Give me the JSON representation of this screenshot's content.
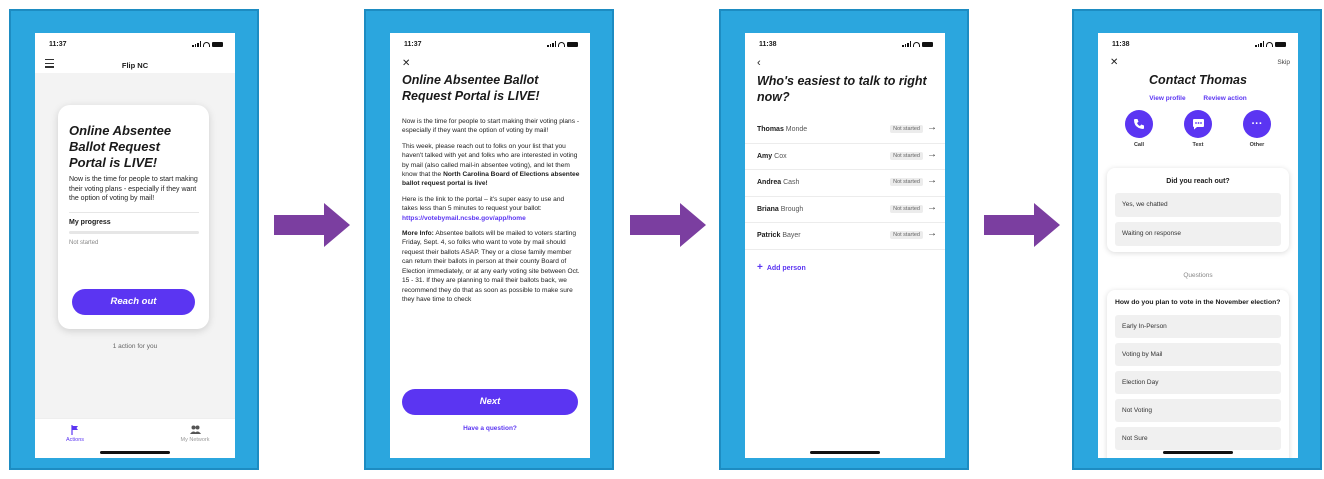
{
  "status": {
    "time1": "11:37",
    "time2": "11:37",
    "time3": "11:38",
    "time4": "11:38"
  },
  "screen1": {
    "header_title": "Flip NC",
    "card_title": "Online Absentee Ballot Request Portal is LIVE!",
    "card_body": "Now is the time for people to start making their voting plans - especially if they want the option of voting by mail!",
    "progress_label": "My progress",
    "progress_status": "Not started",
    "progress": 0,
    "cta": "Reach out",
    "actions_count": "1 action for you",
    "tabs": [
      {
        "label": "Actions",
        "icon": "flag-icon"
      },
      {
        "label": "My Network",
        "icon": "people-icon"
      }
    ]
  },
  "screen2": {
    "title": "Online Absentee Ballot Request Portal is LIVE!",
    "p1": "Now is the time for people to start making their voting plans - especially if they want the option of voting by mail!",
    "p2_a": "This week, please reach out to folks on your list that you haven't talked with yet and folks who are interested in voting by mail (also called mail-in absentee voting), and let them know that the ",
    "p2_b": "North Carolina Board of Elections absentee ballot request portal is live!",
    "p3_a": "Here is the link to the portal – it's super easy to use and takes less than 5 minutes to request your ballot: ",
    "p3_link": "https://votebymail.ncsbe.gov/app/home",
    "p4_label": "More Info:",
    "p4": " Absentee ballots will be mailed to voters starting Friday, Sept. 4, so folks who want to vote by mail should request their ballots ASAP. They or a close family member can return their ballots in person at their county Board of Election immediately, or at any early voting site between Oct. 15 - 31. If they are planning to mail their ballots back, we recommend they do that as soon as possible to make sure they have time to check",
    "next": "Next",
    "question": "Have a question?"
  },
  "screen3": {
    "title": "Who's easiest to talk to right now?",
    "people": [
      {
        "first": "Thomas",
        "last": "Monde",
        "status": "Not started"
      },
      {
        "first": "Amy",
        "last": "Cox",
        "status": "Not started"
      },
      {
        "first": "Andrea",
        "last": "Cash",
        "status": "Not started"
      },
      {
        "first": "Briana",
        "last": "Brough",
        "status": "Not started"
      },
      {
        "first": "Patrick",
        "last": "Bayer",
        "status": "Not started"
      }
    ],
    "add_person": "Add person"
  },
  "screen4": {
    "skip": "Skip",
    "title": "Contact Thomas",
    "view_profile": "View profile",
    "review_action": "Review action",
    "actions": [
      {
        "label": "Call",
        "icon": "phone-icon"
      },
      {
        "label": "Text",
        "icon": "chat-icon"
      },
      {
        "label": "Other",
        "icon": "more-icon"
      }
    ],
    "reach_out_title": "Did you reach out?",
    "reach_out_options": [
      "Yes, we chatted",
      "Waiting on response"
    ],
    "questions_heading": "Questions",
    "question": "How do you plan to vote in the November election?",
    "answers": [
      "Early In-Person",
      "Voting by Mail",
      "Election Day",
      "Not Voting",
      "Not Sure"
    ]
  },
  "colors": {
    "frame": "#2ba6de",
    "accent": "#5b35f2",
    "arrow": "#7b3ea0"
  }
}
